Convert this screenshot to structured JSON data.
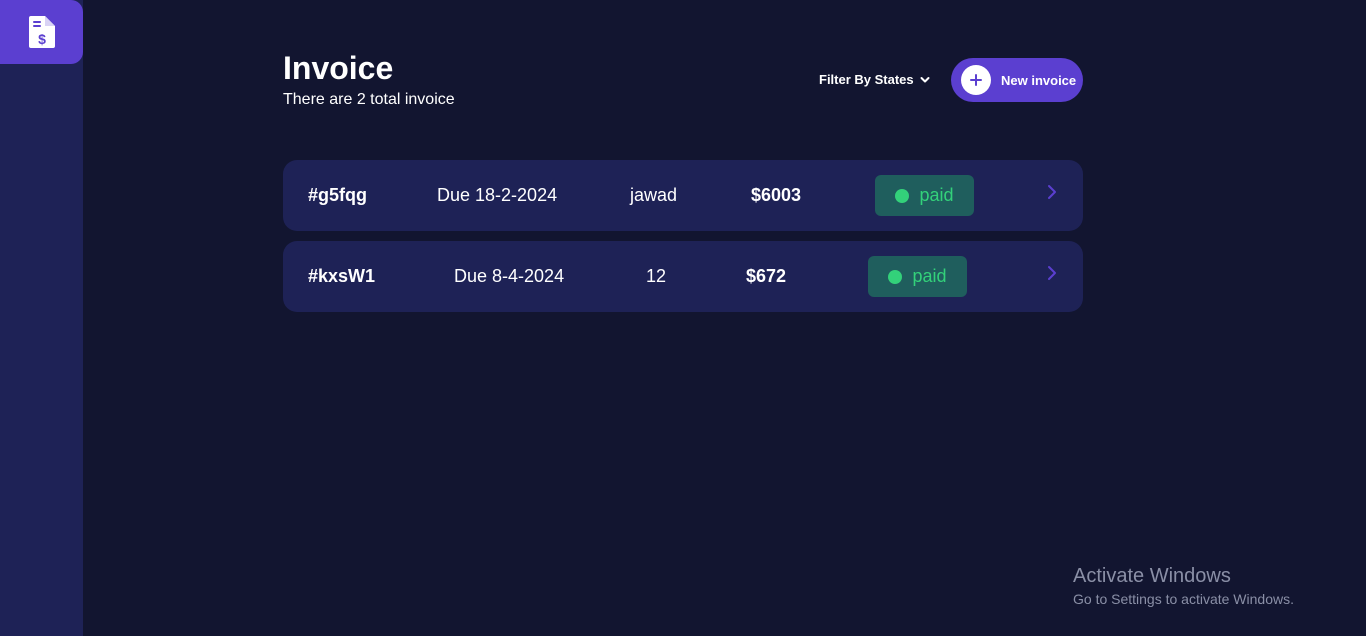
{
  "colors": {
    "background": "#121530",
    "sidebar": "#1e2256",
    "accent": "#5b3fd0",
    "row_background": "#1e2256",
    "status_background": "#1f5e5d",
    "status_paid": "#33d17a",
    "chevron": "#5b3fd0"
  },
  "sidebar": {
    "logo_icon": "invoice-dollar-icon"
  },
  "header": {
    "title": "Invoice",
    "subtitle": "There are 2 total invoice",
    "filter_label": "Filter By States",
    "filter_icon": "chevron-down-icon",
    "new_button_label": "New invoice",
    "new_button_icon": "plus-icon"
  },
  "invoices": [
    {
      "id": "#g5fqg",
      "due": "Due 18-2-2024",
      "client": "jawad",
      "amount": "$6003",
      "status": "paid"
    },
    {
      "id": "#kxsW1",
      "due": "Due 8-4-2024",
      "client": "12",
      "amount": "$672",
      "status": "paid"
    }
  ],
  "watermark": {
    "title": "Activate Windows",
    "subtitle": "Go to Settings to activate Windows."
  }
}
